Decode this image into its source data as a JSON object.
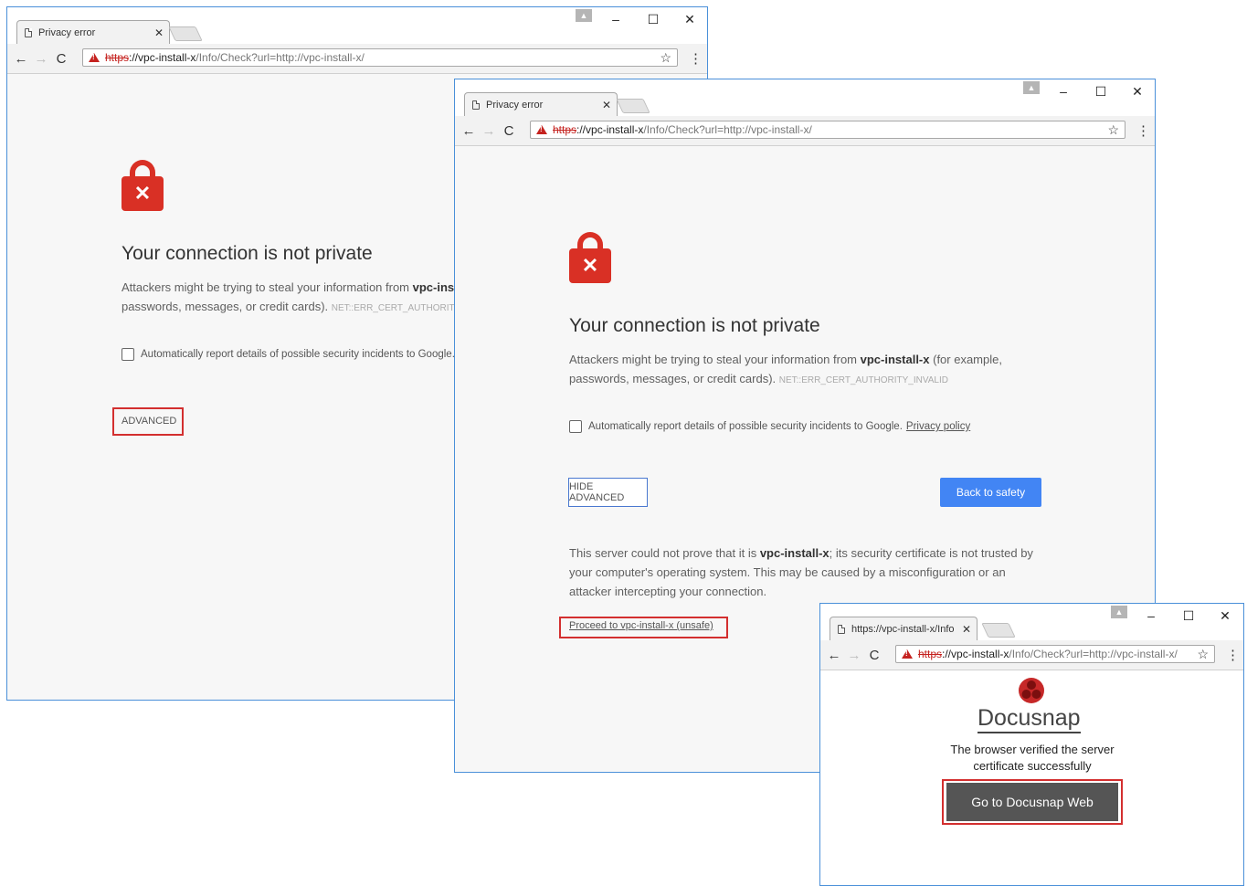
{
  "window1": {
    "tab_title": "Privacy error",
    "url_scheme": "https",
    "url_host": "://vpc-install-x",
    "url_path": "/Info/Check?url=http://vpc-install-x/",
    "heading": "Your connection is not private",
    "paragraph_prefix": "Attackers might be trying to steal your information from ",
    "paragraph_host": "vpc-ins",
    "paragraph_line2": "passwords, messages, or credit cards).",
    "error_code": "NET::ERR_CERT_AUTHORITY_I",
    "checkbox_label": "Automatically report details of possible security incidents to Google.",
    "advanced_label": "ADVANCED"
  },
  "window2": {
    "tab_title": "Privacy error",
    "url_scheme": "https",
    "url_host": "://vpc-install-x",
    "url_path": "/Info/Check?url=http://vpc-install-x/",
    "heading": "Your connection is not private",
    "paragraph_prefix": "Attackers might be trying to steal your information from ",
    "paragraph_host": "vpc-install-x",
    "paragraph_suffix": " (for example,",
    "paragraph_line2": "passwords, messages, or credit cards).",
    "error_code": "NET::ERR_CERT_AUTHORITY_INVALID",
    "checkbox_label": "Automatically report details of possible security incidents to Google.",
    "privacy_policy": "Privacy policy",
    "hide_advanced_label": "HIDE ADVANCED",
    "back_to_safety_label": "Back to safety",
    "details_prefix": "This server could not prove that it is ",
    "details_host": "vpc-install-x",
    "details_rest1": "; its security certificate is not trusted by",
    "details_line2": "your computer's operating system. This may be caused by a misconfiguration or an",
    "details_line3": "attacker intercepting your connection.",
    "proceed_link": "Proceed to vpc-install-x (unsafe)"
  },
  "window3": {
    "tab_title": "https://vpc-install-x/Info",
    "url_scheme": "https",
    "url_host": "://vpc-install-x",
    "url_path": "/Info/Check?url=http://vpc-install-x/",
    "brand_name": "Docusnap",
    "message": "The browser verified the server certificate successfully",
    "button_label": "Go to Docusnap Web"
  },
  "colors": {
    "window_border": "#4a90d9",
    "highlight": "#d32f2f",
    "lock_red": "#d93025",
    "primary_blue": "#4285f4",
    "docusnap_button": "#555555"
  }
}
